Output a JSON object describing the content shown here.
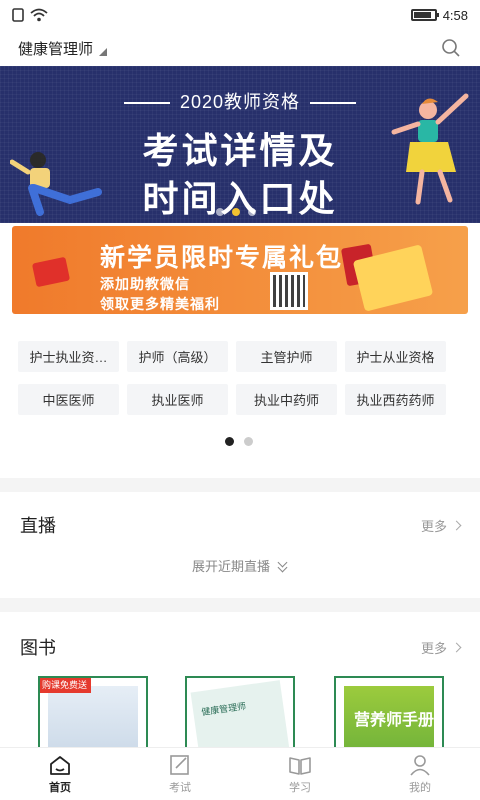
{
  "status": {
    "time": "4:58",
    "battery_level": 0.85
  },
  "header": {
    "title": "健康管理师"
  },
  "banner": {
    "kicker": "2020教师资格",
    "line1": "考试详情及",
    "line2": "时间入口处",
    "slide_count": 3,
    "active_slide": 2
  },
  "promo": {
    "title": "新学员限时专属礼包",
    "line1": "添加助教微信",
    "line2": "领取更多精美福利"
  },
  "categories": [
    "护士执业资…",
    "护师（高级）",
    "主管护师",
    "护士从业资格",
    "中医医师",
    "执业医师",
    "执业中药师",
    "执业西药药师"
  ],
  "live": {
    "title": "直播",
    "more": "更多",
    "expand": "展开近期直播"
  },
  "books": {
    "title": "图书",
    "more": "更多",
    "items": [
      {
        "tag": "购课免费送"
      },
      {
        "cover_text": "健康管理师"
      },
      {
        "cover_text": "营养师手册"
      }
    ]
  },
  "tabs": [
    {
      "label": "首页",
      "icon": "home-icon",
      "active": true
    },
    {
      "label": "考试",
      "icon": "exam-icon",
      "active": false
    },
    {
      "label": "学习",
      "icon": "book-icon",
      "active": false
    },
    {
      "label": "我的",
      "icon": "profile-icon",
      "active": false
    }
  ],
  "colors": {
    "banner_bg": "#27306b",
    "promo_bg": "#f07a2b",
    "accent_green": "#2d8a53"
  }
}
